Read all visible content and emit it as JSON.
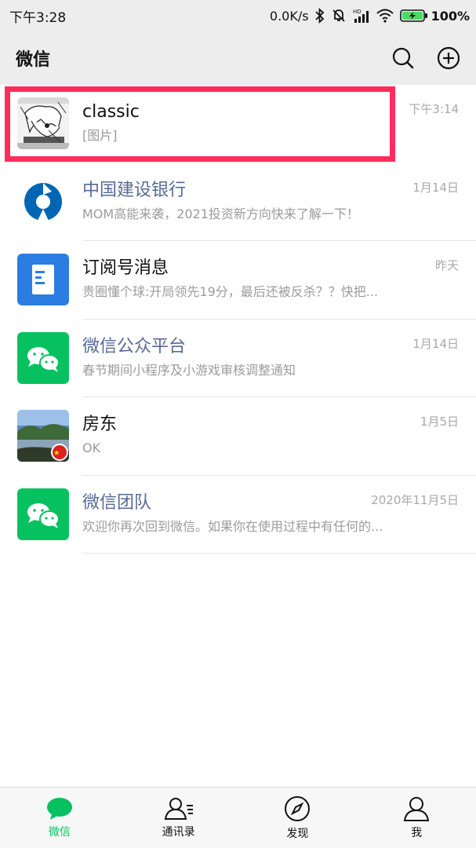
{
  "status_bar": {
    "time": "下午3:28",
    "network_speed": "0.0K/s",
    "battery": "100%"
  },
  "header": {
    "title": "微信",
    "icons": [
      "search-icon",
      "add-icon"
    ]
  },
  "chats": [
    {
      "name": "classic",
      "preview": "[图片]",
      "time": "下午3:14",
      "avatar": "manga-avatar",
      "official": false,
      "highlighted": true
    },
    {
      "name": "中国建设银行",
      "preview": "MOM高能来袭，2021投资新方向快来了解一下！",
      "time": "1月14日",
      "avatar": "ccb-logo",
      "official": true
    },
    {
      "name": "订阅号消息",
      "preview": "贵圈懂个球:开局领先19分，最后还被反杀？？快把...",
      "time": "昨天",
      "avatar": "subscription-icon",
      "official": false
    },
    {
      "name": "微信公众平台",
      "preview": "春节期间小程序及小游戏审核调整通知",
      "time": "1月14日",
      "avatar": "wechat-logo",
      "official": true
    },
    {
      "name": "房东",
      "preview": "OK",
      "time": "1月5日",
      "avatar": "landscape-avatar",
      "official": false
    },
    {
      "name": "微信团队",
      "preview": "欢迎你再次回到微信。如果你在使用过程中有任何的...",
      "time": "2020年11月5日",
      "avatar": "wechat-logo",
      "official": true
    }
  ],
  "tabs": [
    {
      "label": "微信",
      "icon": "chat-bubble-icon",
      "active": true
    },
    {
      "label": "通讯录",
      "icon": "contacts-icon",
      "active": false
    },
    {
      "label": "发现",
      "icon": "compass-icon",
      "active": false
    },
    {
      "label": "我",
      "icon": "person-icon",
      "active": false
    }
  ],
  "colors": {
    "accent": "#07c160",
    "highlight": "#ff2c5c",
    "official_name": "#576b95",
    "bank_blue": "#0066b3",
    "subscription_blue": "#2b7de1"
  }
}
